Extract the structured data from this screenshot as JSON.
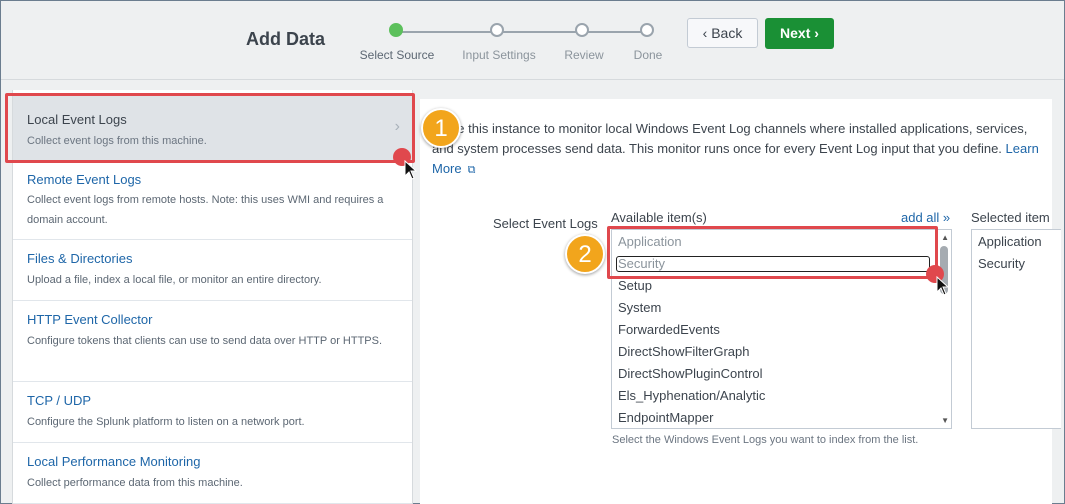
{
  "header": {
    "title": "Add Data",
    "back_label": "Back",
    "next_label": "Next",
    "steps": [
      {
        "label": "Select Source",
        "active": true
      },
      {
        "label": "Input Settings",
        "active": false
      },
      {
        "label": "Review",
        "active": false
      },
      {
        "label": "Done",
        "active": false
      }
    ]
  },
  "sidebar": {
    "items": [
      {
        "title": "Local Event Logs",
        "desc": "Collect event logs from this machine."
      },
      {
        "title": "Remote Event Logs",
        "desc": "Collect event logs from remote hosts. Note: this uses WMI and requires a domain account."
      },
      {
        "title": "Files & Directories",
        "desc": "Upload a file, index a local file, or monitor an entire directory."
      },
      {
        "title": "HTTP Event Collector",
        "desc": "Configure tokens that clients can use to send data over HTTP or HTTPS."
      },
      {
        "title": "TCP / UDP",
        "desc": "Configure the Splunk platform to listen on a network port."
      },
      {
        "title": "Local Performance Monitoring",
        "desc": "Collect performance data from this machine."
      }
    ]
  },
  "main": {
    "intro": "figure this instance to monitor local Windows Event Log channels where installed applications, services, and system processes send data. This monitor runs once for every Event Log input that you define.",
    "learn_more": "Learn More",
    "field_label": "Select Event Logs",
    "available_label": "Available item(s)",
    "add_all": "add all »",
    "selected_label": "Selected item",
    "available_items": [
      "Application",
      "Security",
      "Setup",
      "System",
      "ForwardedEvents",
      "DirectShowFilterGraph",
      "DirectShowPluginControl",
      "Els_Hyphenation/Analytic",
      "EndpointMapper"
    ],
    "selected_items": [
      "Application",
      "Security"
    ],
    "hint": "Select the Windows Event Logs you want to index from the list."
  },
  "callouts": {
    "one": "1",
    "two": "2"
  },
  "colors": {
    "accent": "#1e66a8",
    "next_button": "#1a9035",
    "highlight": "#e0484d",
    "callout": "#f2a51c"
  }
}
